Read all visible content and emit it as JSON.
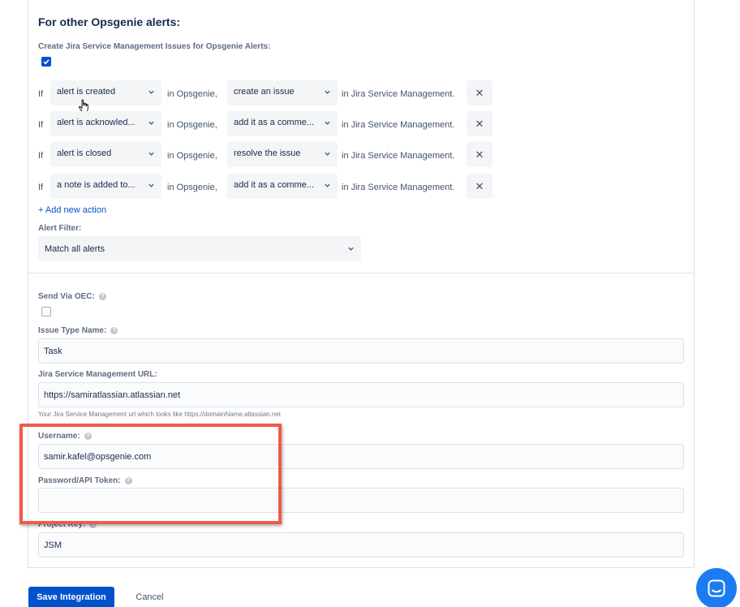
{
  "section": {
    "title": "For other Opsgenie alerts:",
    "create_label": "Create Jira Service Management Issues for Opsgenie Alerts:",
    "create_checked": true
  },
  "rules": [
    {
      "if": "If",
      "trigger": "alert is created",
      "mid": "in Opsgenie,",
      "action": "create an issue",
      "tail": "in Jira Service Management.",
      "remove": "✕"
    },
    {
      "if": "If",
      "trigger": "alert is acknowled...",
      "mid": "in Opsgenie,",
      "action": "add it as a comme...",
      "tail": "in Jira Service Management.",
      "remove": "✕"
    },
    {
      "if": "If",
      "trigger": "alert is closed",
      "mid": "in Opsgenie,",
      "action": "resolve the issue",
      "tail": "in Jira Service Management.",
      "remove": "✕"
    },
    {
      "if": "If",
      "trigger": "a note is added to...",
      "mid": "in Opsgenie,",
      "action": "add it as a comme...",
      "tail": "in Jira Service Management.",
      "remove": "✕"
    }
  ],
  "add_action": "+ Add new action",
  "alert_filter": {
    "label": "Alert Filter:",
    "value": "Match all alerts"
  },
  "send_via_oec": {
    "label": "Send Via OEC:",
    "checked": false
  },
  "issue_type": {
    "label": "Issue Type Name:",
    "value": "Task"
  },
  "jsm_url": {
    "label": "Jira Service Management URL:",
    "value": "https://samiratlassian.atlassian.net",
    "hint": "Your Jira Service Management url which looks like https://domainName.atlassian.net"
  },
  "username": {
    "label": "Username:",
    "value": "samir.kafel@opsgenie.com"
  },
  "password": {
    "label": "Password/API Token:",
    "value": ""
  },
  "project_key": {
    "label": "Project Key:",
    "value": "JSM"
  },
  "buttons": {
    "save": "Save Integration",
    "cancel": "Cancel"
  },
  "colors": {
    "primary": "#0052cc",
    "highlight": "#ef5a4b",
    "chat": "#1d7bf2"
  },
  "icons": {
    "help": "help-icon",
    "chevron": "chevron-down-icon",
    "remove": "close-icon",
    "chat": "chat-icon",
    "cursor": "hand-cursor-icon"
  }
}
